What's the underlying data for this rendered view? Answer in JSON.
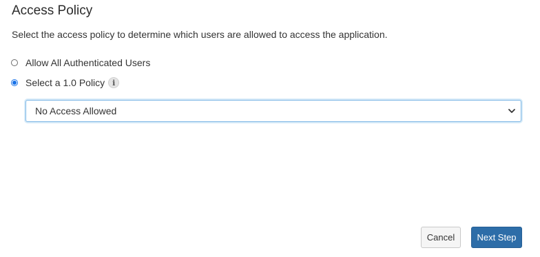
{
  "page": {
    "title": "Access Policy",
    "description": "Select the access policy to determine which users are allowed to access the application."
  },
  "options": [
    {
      "label": "Allow All Authenticated Users",
      "selected": false
    },
    {
      "label": "Select a 1.0 Policy",
      "selected": true
    }
  ],
  "info_icon": {
    "glyph": "i",
    "icon": "info-icon"
  },
  "policy_select": {
    "value": "No Access Allowed",
    "icon": "chevron-down-icon"
  },
  "buttons": {
    "cancel": "Cancel",
    "next": "Next Step"
  },
  "colors": {
    "primary": "#2d6da8",
    "radio_accent": "#1a73e8",
    "select_focus_border": "#7fb8e6"
  }
}
